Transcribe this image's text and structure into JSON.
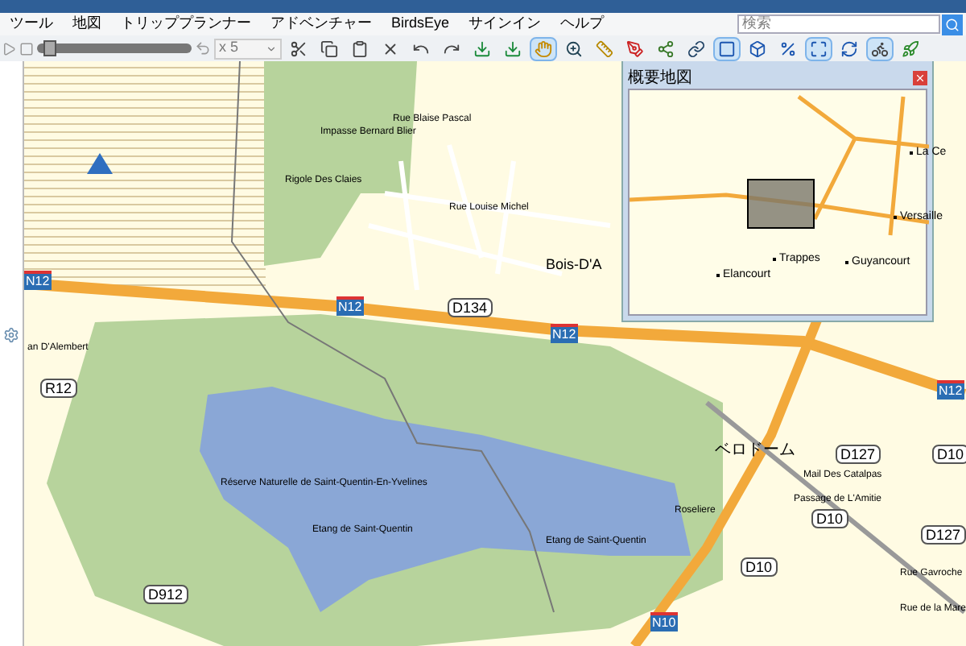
{
  "menu": [
    "ツール",
    "地図",
    "トリッププランナー",
    "アドベンチャー",
    "BirdsEye",
    "サインイン",
    "ヘルプ"
  ],
  "search": {
    "placeholder": "検索"
  },
  "toolbar": {
    "speed": {
      "level": 0.05
    },
    "multiplier": "x 5",
    "map_tools": [
      {
        "selected": true
      },
      {
        "selected": false
      },
      {
        "selected": false
      }
    ],
    "view_toggles": [
      {
        "selected": true
      },
      {
        "selected": false
      },
      {
        "selected": false
      },
      {
        "selected": true
      },
      {
        "selected": false
      }
    ]
  },
  "map": {
    "labels": [
      {
        "kind": "street",
        "text": "Rue Blaise Pascal"
      },
      {
        "kind": "street",
        "text": "Impasse Bernard Blier"
      },
      {
        "kind": "street",
        "text": "Rigole Des Claies"
      },
      {
        "kind": "street",
        "text": "Rue Louise Michel"
      },
      {
        "kind": "town",
        "text": "Bois-D'A"
      },
      {
        "kind": "shield",
        "text": "N12"
      },
      {
        "kind": "shield",
        "text": "N12"
      },
      {
        "kind": "shield",
        "text": "N12"
      },
      {
        "kind": "shield",
        "text": "N12"
      },
      {
        "kind": "route",
        "text": "D134"
      },
      {
        "kind": "route",
        "text": "R12"
      },
      {
        "kind": "street",
        "text": "an D'Alembert"
      },
      {
        "kind": "street",
        "text": "Réserve Naturelle de Saint-Quentin-En-Yvelines"
      },
      {
        "kind": "street",
        "text": "Etang de Saint-Quentin"
      },
      {
        "kind": "street",
        "text": "Etang de Saint-Quentin"
      },
      {
        "kind": "route",
        "text": "D912"
      },
      {
        "kind": "shield",
        "text": "N10"
      },
      {
        "kind": "poi",
        "text": "ベロドーム"
      },
      {
        "kind": "street",
        "text": "Mail Des Catalpas"
      },
      {
        "kind": "street",
        "text": "Passage de L'Amitie"
      },
      {
        "kind": "street",
        "text": "Roseliere"
      },
      {
        "kind": "route",
        "text": "D127"
      },
      {
        "kind": "route",
        "text": "D10"
      },
      {
        "kind": "route",
        "text": "D10"
      },
      {
        "kind": "route",
        "text": "D10"
      },
      {
        "kind": "route",
        "text": "D127"
      },
      {
        "kind": "street",
        "text": "Rue Gavroche"
      },
      {
        "kind": "street",
        "text": "Rue de la Mare"
      }
    ]
  },
  "overview": {
    "title": "概要地図",
    "places": [
      "La Ce",
      "Versaille",
      "Elancourt",
      "Guyancourt",
      "Trappes"
    ]
  }
}
